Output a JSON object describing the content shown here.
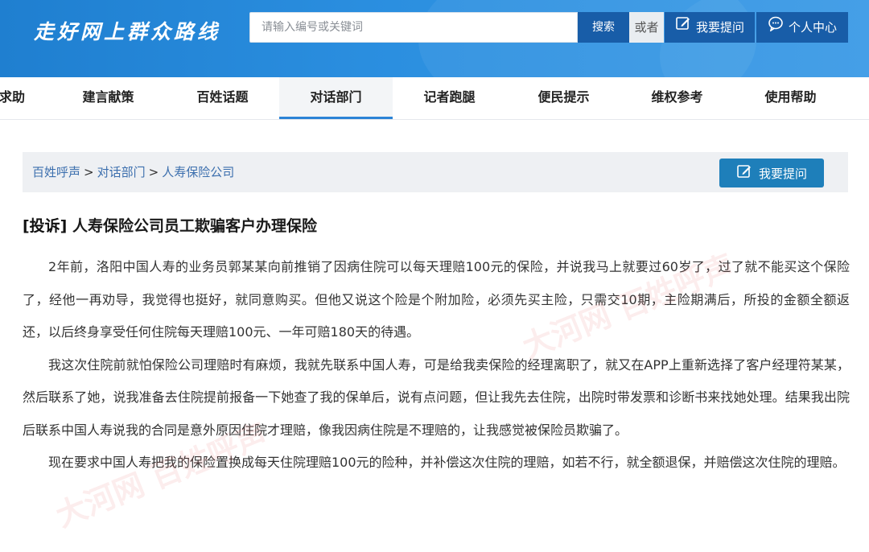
{
  "header": {
    "site_title": "走好网上群众路线",
    "search": {
      "placeholder": "请输入编号或关键词",
      "value": ""
    },
    "search_button": "搜索",
    "or_label": "或者",
    "ask_button": "我要提问",
    "user_center_button": "个人中心",
    "icons": {
      "ask": "edit-icon",
      "user_center": "chat-bubble-icon"
    }
  },
  "nav": {
    "items": [
      {
        "label": "求助",
        "active": false
      },
      {
        "label": "建言献策",
        "active": false
      },
      {
        "label": "百姓话题",
        "active": false
      },
      {
        "label": "对话部门",
        "active": true
      },
      {
        "label": "记者跑腿",
        "active": false
      },
      {
        "label": "便民提示",
        "active": false
      },
      {
        "label": "维权参考",
        "active": false
      },
      {
        "label": "使用帮助",
        "active": false
      }
    ]
  },
  "breadcrumb": {
    "items": [
      "百姓呼声",
      "对话部门",
      "人寿保险公司"
    ],
    "separator": ">",
    "ask_button": "我要提问"
  },
  "article": {
    "tag": "[投诉]",
    "title": "人寿保险公司员工欺骗客户办理保险",
    "paragraphs": [
      "2年前，洛阳中国人寿的业务员郭某某向前推销了因病住院可以每天理赔100元的保险，并说我马上就要过60岁了，过了就不能买这个保险了，经他一再劝导，我觉得也挺好，就同意购买。但他又说这个险是个附加险，必须先买主险，只需交10期，主险期满后，所投的金额全额返还，以后终身享受任何住院每天理赔100元、一年可赔180天的待遇。",
      "我这次住院前就怕保险公司理赔时有麻烦，我就先联系中国人寿，可是给我卖保险的经理离职了，就又在APP上重新选择了客户经理符某某，然后联系了她，说我准备去住院提前报备一下她查了我的保单后，说有点问题，但让我先去住院，出院时带发票和诊断书来找她处理。结果我出院后联系中国人寿说我的合同是意外原因住院才理赔，像我因病住院是不理赔的，让我感觉被保险员欺骗了。",
      "现在要求中国人寿把我的保险置换成每天住院理赔100元的险种，并补偿这次住院的理赔，如若不行，就全额退保，并赔偿这次住院的理赔。"
    ]
  },
  "watermark": "大河网 百姓呼声",
  "colors": {
    "header_bg": "#2b8fe0",
    "button_dark": "#185da8",
    "ask_button": "#1e7fba",
    "link": "#3c6fae",
    "nav_active_underline": "#2b83d6"
  }
}
